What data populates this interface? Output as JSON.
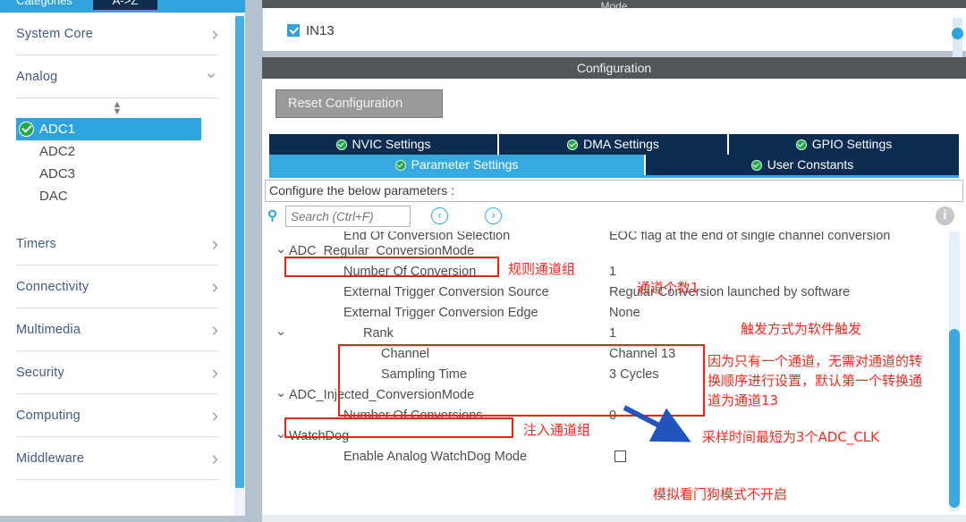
{
  "sidebar": {
    "tabs": [
      {
        "label": "Categories",
        "active": true
      },
      {
        "label": "A->Z",
        "active": false
      }
    ],
    "categories": [
      {
        "label": "System Core",
        "chevron": "chevron-right-icon"
      },
      {
        "label": "Analog",
        "chevron": "chevron-down-icon"
      },
      {
        "label": "Timers",
        "chevron": "chevron-right-icon"
      },
      {
        "label": "Connectivity",
        "chevron": "chevron-right-icon"
      },
      {
        "label": "Multimedia",
        "chevron": "chevron-right-icon"
      },
      {
        "label": "Security",
        "chevron": "chevron-right-icon"
      },
      {
        "label": "Computing",
        "chevron": "chevron-right-icon"
      },
      {
        "label": "Middleware",
        "chevron": "chevron-right-icon"
      }
    ],
    "analog_children": [
      {
        "label": "ADC1",
        "selected": true,
        "status": "configured-ok-icon"
      },
      {
        "label": "ADC2",
        "selected": false,
        "status": ""
      },
      {
        "label": "ADC3",
        "selected": false,
        "status": ""
      },
      {
        "label": "DAC",
        "selected": false,
        "status": ""
      }
    ]
  },
  "mode_panel": {
    "header": "Mode",
    "checkbox_label": "IN13",
    "checkbox_checked": true
  },
  "config_panel": {
    "header": "Configuration",
    "reset_button": "Reset Configuration",
    "tabs_row1": [
      {
        "label": "NVIC Settings",
        "active": false
      },
      {
        "label": "DMA Settings",
        "active": false
      },
      {
        "label": "GPIO Settings",
        "active": false
      }
    ],
    "tabs_row2": [
      {
        "label": "Parameter Settings",
        "active": true
      },
      {
        "label": "User Constants",
        "active": false
      }
    ],
    "configure_hint": "Configure the below parameters :",
    "search_placeholder": "Search (Ctrl+F)",
    "search_value": "",
    "prev_label": "‹",
    "next_label": "›",
    "info_label": "i"
  },
  "parameters": [
    {
      "indent": 1,
      "expander": "",
      "name": "End Of Conversion Selection",
      "value": "EOC flag at the end of single channel conversion",
      "type": "text"
    },
    {
      "indent": 0,
      "expander": "⌄",
      "name": "ADC_Regular_ConversionMode",
      "value": "",
      "type": "text"
    },
    {
      "indent": 1,
      "expander": "",
      "name": "Number Of Conversion",
      "value": "1",
      "type": "text"
    },
    {
      "indent": 1,
      "expander": "",
      "name": "External Trigger Conversion Source",
      "value": "Regular Conversion launched by software",
      "type": "text"
    },
    {
      "indent": 1,
      "expander": "",
      "name": "External Trigger Conversion Edge",
      "value": "None",
      "type": "text"
    },
    {
      "indent": 2,
      "expander": "⌄",
      "name": "Rank",
      "value": "1",
      "type": "text"
    },
    {
      "indent": 3,
      "expander": "",
      "name": "Channel",
      "value": "Channel 13",
      "type": "text"
    },
    {
      "indent": 3,
      "expander": "",
      "name": "Sampling Time",
      "value": "3 Cycles",
      "type": "text"
    },
    {
      "indent": 0,
      "expander": "⌄",
      "name": "ADC_Injected_ConversionMode",
      "value": "",
      "type": "text"
    },
    {
      "indent": 1,
      "expander": "",
      "name": "Number Of Conversions",
      "value": "0",
      "type": "text"
    },
    {
      "indent": 0,
      "expander": "⌄",
      "name": "WatchDog",
      "value": "",
      "type": "text"
    },
    {
      "indent": 1,
      "expander": "",
      "name": "Enable Analog WatchDog Mode",
      "value": "",
      "type": "checkbox",
      "checked": false
    }
  ],
  "annotations": {
    "color": "#ff2a20",
    "arrow_color": "#2255bb",
    "notes": [
      {
        "id": "regular-group",
        "text": "规则通道组"
      },
      {
        "id": "channel-count",
        "text": "通道个数1"
      },
      {
        "id": "trigger-mode",
        "text": "触发方式为软件触发"
      },
      {
        "id": "rank-note-1",
        "text": "因为只有一个通道，无需对通道的转"
      },
      {
        "id": "rank-note-2",
        "text": "换顺序进行设置，默认第一个转换通"
      },
      {
        "id": "rank-note-3",
        "text": "道为通道13"
      },
      {
        "id": "sampling-note",
        "text": "采样时间最短为3个ADC_CLK"
      },
      {
        "id": "injected-group",
        "text": "注入通道组"
      },
      {
        "id": "watchdog-note",
        "text": "模拟看门狗模式不开启"
      }
    ]
  },
  "colors": {
    "accent_blue": "#2ea3dd",
    "tab_navy": "#0d2c52",
    "panel_gray": "#b4c2ce",
    "header_dark": "#53565a",
    "ok_green": "#1faa4a",
    "annotation_red": "#ff2a20"
  }
}
